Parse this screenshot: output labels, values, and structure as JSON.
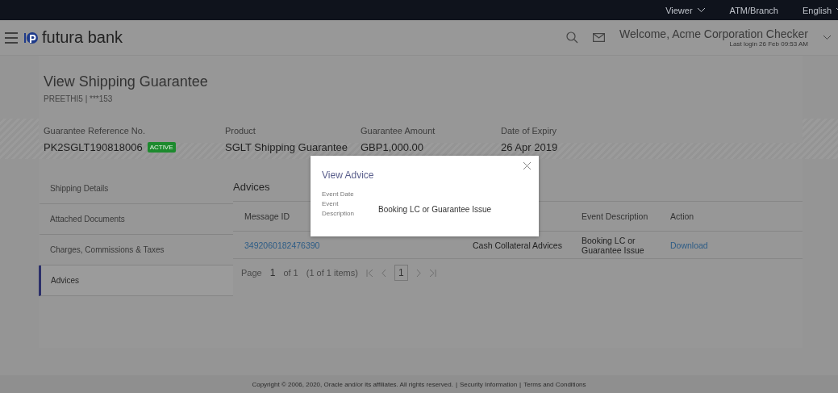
{
  "top_bar": {
    "items": [
      {
        "label": "Viewer",
        "dropdown": true
      },
      {
        "label": "ATM/Branch",
        "dropdown": false
      },
      {
        "label": "English",
        "dropdown": true
      }
    ]
  },
  "header": {
    "logo": "futura bank",
    "welcome": "Welcome, Acme Corporation Checker",
    "last_login": "Last login 26 Feb 09:53 AM"
  },
  "page": {
    "title": "View Shipping Guarantee",
    "subtitle": "PREETHI5 | ***153"
  },
  "summary": [
    {
      "label": "Guarantee Reference No.",
      "value": "PK2SGLT190818006",
      "badge": "ACTIVE"
    },
    {
      "label": "Product",
      "value": "SGLT Shipping Guarantee"
    },
    {
      "label": "Guarantee Amount",
      "value": "GBP1,000.00"
    },
    {
      "label": "Date of Expiry",
      "value": "26 Apr 2019"
    }
  ],
  "sidebar": {
    "items": [
      {
        "label": "Shipping Details",
        "selected": false
      },
      {
        "label": "Attached Documents",
        "selected": false
      },
      {
        "label": "Charges, Commissions & Taxes",
        "selected": false
      },
      {
        "label": "Advices",
        "selected": true
      }
    ]
  },
  "advices": {
    "title": "Advices",
    "table": {
      "columns": [
        "Message ID",
        null,
        "Event Description",
        "Action"
      ],
      "rows": [
        [
          "3492060182476390",
          "Cash Collateral Advices",
          "Booking LC or Guarantee Issue",
          "Download"
        ]
      ]
    },
    "pagination": {
      "page_label": "Page",
      "page": "1",
      "of": "of 1",
      "items": "(1 of 1 items)",
      "current": "1"
    }
  },
  "modal": {
    "title": "View Advice",
    "fields": [
      {
        "label": "Event Date"
      },
      {
        "label": "Event Description",
        "value": "Booking LC or Guarantee Issue"
      }
    ]
  },
  "footer": {
    "copyright": "Copyright © 2006, 2020, Oracle and/or its affiliates. All rights reserved.",
    "separator": "|",
    "links": [
      "Security Information",
      "Terms and Conditions"
    ]
  }
}
